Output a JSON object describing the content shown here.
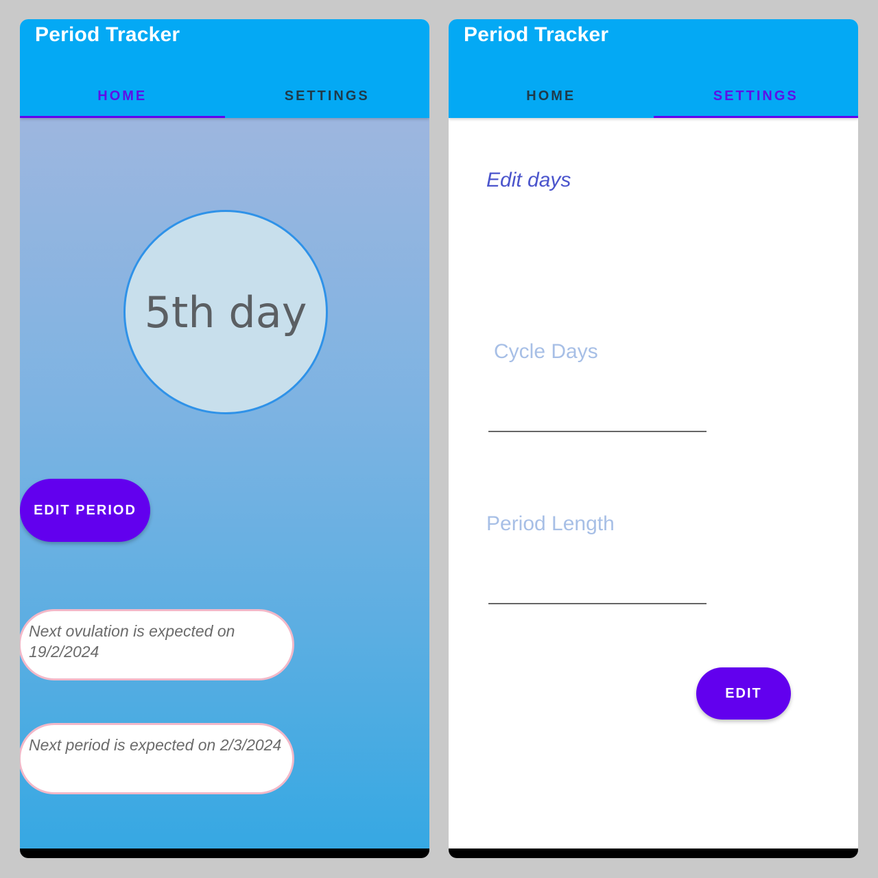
{
  "colors": {
    "appbar": "#04a9f4",
    "accent": "#6200ee",
    "tab_text": "#1f3a4a",
    "active_tab_text": "#5e10e6",
    "circle_fill": "#c8dfec",
    "circle_border": "#2f92e8",
    "pill_border": "#f2b8c8",
    "label_hint": "#a7bfe6",
    "edit_days": "#4b55cc",
    "page_background": "#c9c9c9"
  },
  "home_screen": {
    "app_title": "Period Tracker",
    "tabs": [
      {
        "label": "HOME",
        "active": true
      },
      {
        "label": "SETTINGS",
        "active": false
      }
    ],
    "cycle_day": "5th day",
    "edit_period_label": "EDIT PERIOD",
    "ovulation_text": "Next ovulation is expected on 19/2/2024",
    "next_period_text": "Next period is expected on 2/3/2024"
  },
  "settings_screen": {
    "app_title": "Period Tracker",
    "tabs": [
      {
        "label": "HOME",
        "active": false
      },
      {
        "label": "SETTINGS",
        "active": true
      }
    ],
    "section_title": "Edit days",
    "fields": [
      {
        "label": "Cycle Days",
        "value": ""
      },
      {
        "label": "Period Length",
        "value": ""
      }
    ],
    "edit_label": "EDIT"
  }
}
